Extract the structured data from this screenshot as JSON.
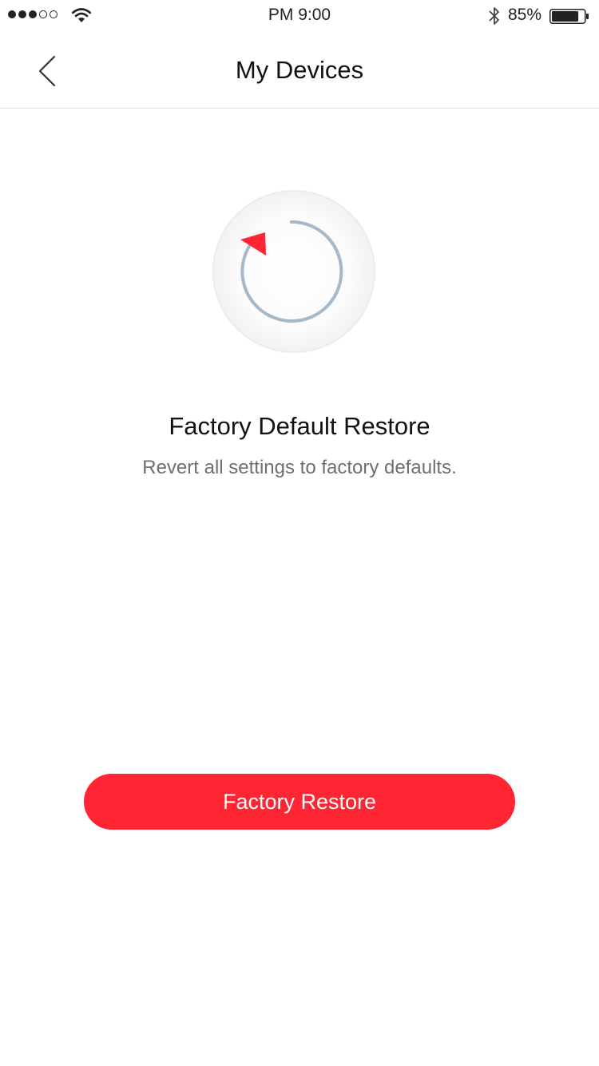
{
  "status_bar": {
    "signal_bars_filled": 3,
    "signal_bars_total": 5,
    "time": "PM   9:00",
    "battery_percent": "85%",
    "battery_level": 0.85
  },
  "nav": {
    "title": "My Devices",
    "back_icon": "chevron-left-icon"
  },
  "illustration": {
    "icon": "restore-icon",
    "ring_color": "#a6b8c8",
    "arrow_color": "#ff2533"
  },
  "content": {
    "title": "Factory Default Restore",
    "subtitle": "Revert all settings to factory defaults."
  },
  "actions": {
    "restore_label": "Factory Restore",
    "restore_color": "#ff2533"
  }
}
